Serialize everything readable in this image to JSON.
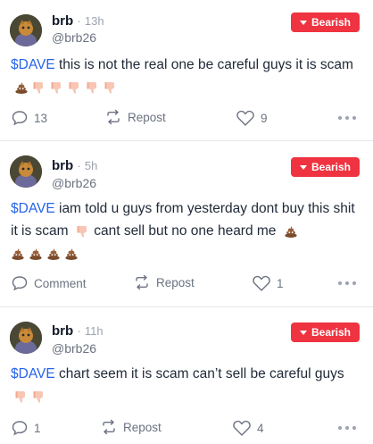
{
  "badge_color": "#ef3340",
  "ticker_color": "#2563eb",
  "posts": [
    {
      "username": "brb",
      "separator": "·",
      "time": "13h",
      "handle": "@brb26",
      "badge": "Bearish",
      "ticker": "$DAVE",
      "text_1": " this is not the real one be careful guys it is scam",
      "emoji_1": [
        "poop-emoji",
        "thumbs-down-emoji",
        "thumbs-down-emoji",
        "thumbs-down-emoji",
        "thumbs-down-emoji",
        "thumbs-down-emoji"
      ],
      "comment": "13",
      "repost": "Repost",
      "like": "9"
    },
    {
      "username": "brb",
      "separator": "·",
      "time": "5h",
      "handle": "@brb26",
      "badge": "Bearish",
      "ticker": "$DAVE",
      "text_1": " iam told u guys from yesterday dont buy this shit it is scam",
      "text_2": " cant sell but no one heard me",
      "emoji_1": [
        "thumbs-down-emoji"
      ],
      "emoji_2": [
        "poop-emoji",
        "poop-emoji",
        "poop-emoji",
        "poop-emoji",
        "poop-emoji"
      ],
      "comment": "Comment",
      "repost": "Repost",
      "like": "1"
    },
    {
      "username": "brb",
      "separator": "·",
      "time": "11h",
      "handle": "@brb26",
      "badge": "Bearish",
      "ticker": "$DAVE",
      "text_1": " chart seem it is scam can’t sell be careful guys",
      "emoji_1": [
        "thumbs-down-emoji",
        "thumbs-down-emoji"
      ],
      "comment": "1",
      "repost": "Repost",
      "like": "4"
    }
  ]
}
